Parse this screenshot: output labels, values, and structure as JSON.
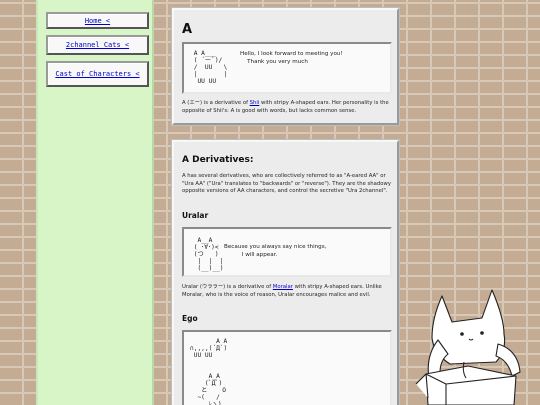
{
  "sidebar": {
    "links": [
      {
        "label": "Home <"
      },
      {
        "label": "2channel Cats <"
      },
      {
        "label": "Cast of Characters <"
      }
    ]
  },
  "intro": {
    "title": "A",
    "art": " A A___\n ( ´ー`)/\n /  UU   \\\n |       |\n  UU UU",
    "speech": "Hello, I look forward to meeting you!\n    Thank you very much",
    "desc_before": "A (エー) is a derivative of ",
    "desc_link": "Shii",
    "desc_after": " with stripy A-shaped ears. Her personality is the opposite of Shii's: A is good with words, but lacks common sense."
  },
  "derivatives": {
    "title": "A Derivatives:",
    "desc": "A has several derivatives, who are collectively referred to as \"A-eared AA\" or \"Ura AA\" (\"Ura\" translates to \"backwards\" or \"reverse\"). They are the shadowy opposite versions of AA characters, and control the secretive \"Ura 2channel\".",
    "uralar": {
      "title": "Uralar",
      "art": "  A__A\n ( ･∀･)<\n (つ   )\n  |  |  |\n  (__)__)",
      "speech": "Because you always say nice things,\n          I will appear.",
      "desc_before": "Uralar (ウララー) is a derivative of ",
      "desc_link": "Moralar",
      "desc_after": " with stripy A-shaped ears. Unlike Moralar, who is the voice of reason, Uralar encourages malice and evil."
    },
    "ego": {
      "title": "Ego",
      "art": "       A A\n∩,,,,(´Д`)\n UU UU\n\n\n     A_A\n    (ﾟДﾟ)\n   と    O\n  ~(   /\n     ﾚヽ)"
    }
  },
  "colors": {
    "background": "#c4ab93",
    "sidebar": "#d8f5c8",
    "panel": "#ececec",
    "link": "#0000cc"
  }
}
